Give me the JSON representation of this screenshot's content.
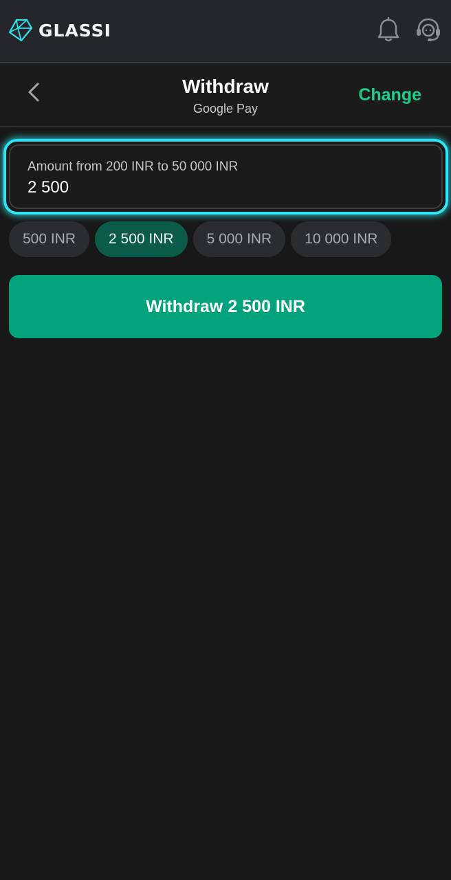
{
  "app": {
    "brand": "GLASSI"
  },
  "colors": {
    "accent_green": "#1fcf8a",
    "button_green": "#02a27c",
    "chip_active": "#0b5b4b",
    "focus_cyan": "#2ee3f3",
    "background": "#181818",
    "topbar": "#25262a"
  },
  "icons": {
    "logo": "diamond-icon",
    "notifications": "bell-icon",
    "support": "headset-icon",
    "back": "chevron-left-icon"
  },
  "header": {
    "title": "Withdraw",
    "subtitle": "Google Pay",
    "change_label": "Change"
  },
  "amount": {
    "label": "Amount from 200 INR to 50 000 INR",
    "value": "2 500"
  },
  "presets": [
    {
      "label": "500 INR",
      "selected": false
    },
    {
      "label": "2 500 INR",
      "selected": true
    },
    {
      "label": "5 000 INR",
      "selected": false
    },
    {
      "label": "10 000 INR",
      "selected": false
    }
  ],
  "submit": {
    "label": "Withdraw 2 500 INR"
  }
}
